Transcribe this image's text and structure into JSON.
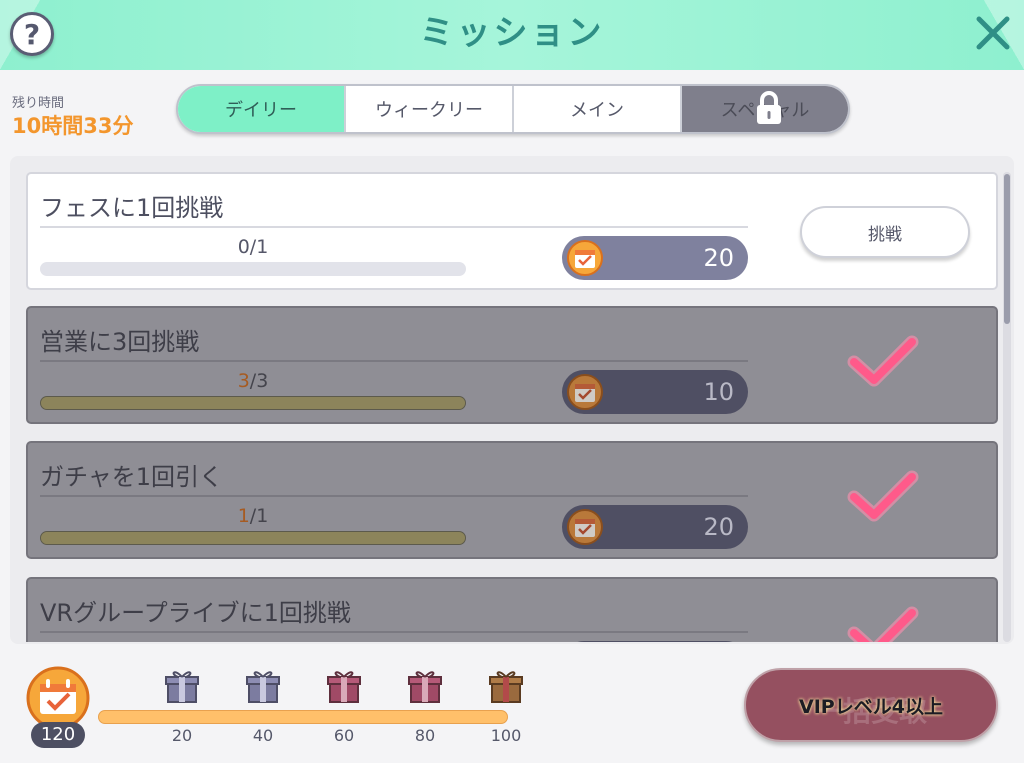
{
  "header": {
    "title": "ミッション",
    "help_icon": "?",
    "close_icon": "close-icon"
  },
  "time_left": {
    "label": "残り時間",
    "value": "10時間33分"
  },
  "tabs": [
    {
      "label": "デイリー",
      "state": "active"
    },
    {
      "label": "ウィークリー",
      "state": "normal"
    },
    {
      "label": "メイン",
      "state": "normal"
    },
    {
      "label": "スペシャル",
      "state": "locked"
    }
  ],
  "missions": [
    {
      "title": "フェスに1回挑戦",
      "progress_current": "0",
      "progress_total": "/1",
      "progress_fraction": 0.0,
      "reward": "20",
      "status": "active",
      "button_label": "挑戦"
    },
    {
      "title": "営業に3回挑戦",
      "progress_current": "3",
      "progress_total": "/3",
      "progress_fraction": 1.0,
      "reward": "10",
      "status": "done"
    },
    {
      "title": "ガチャを1回引く",
      "progress_current": "1",
      "progress_total": "/1",
      "progress_fraction": 1.0,
      "reward": "20",
      "status": "done"
    },
    {
      "title": "VRグループライブに1回挑戦",
      "status": "done"
    }
  ],
  "footer": {
    "points": "120",
    "milestones": [
      "20",
      "40",
      "60",
      "80",
      "100"
    ],
    "progress_fraction": 1.0,
    "vip_bg_label": "一括受取",
    "vip_label": "VIPレベル4以上"
  },
  "colors": {
    "accent": "#7ef0c7",
    "title": "#2f8f86",
    "time": "#f3962d",
    "check": "#ff5a8a",
    "vip": "#955060"
  }
}
